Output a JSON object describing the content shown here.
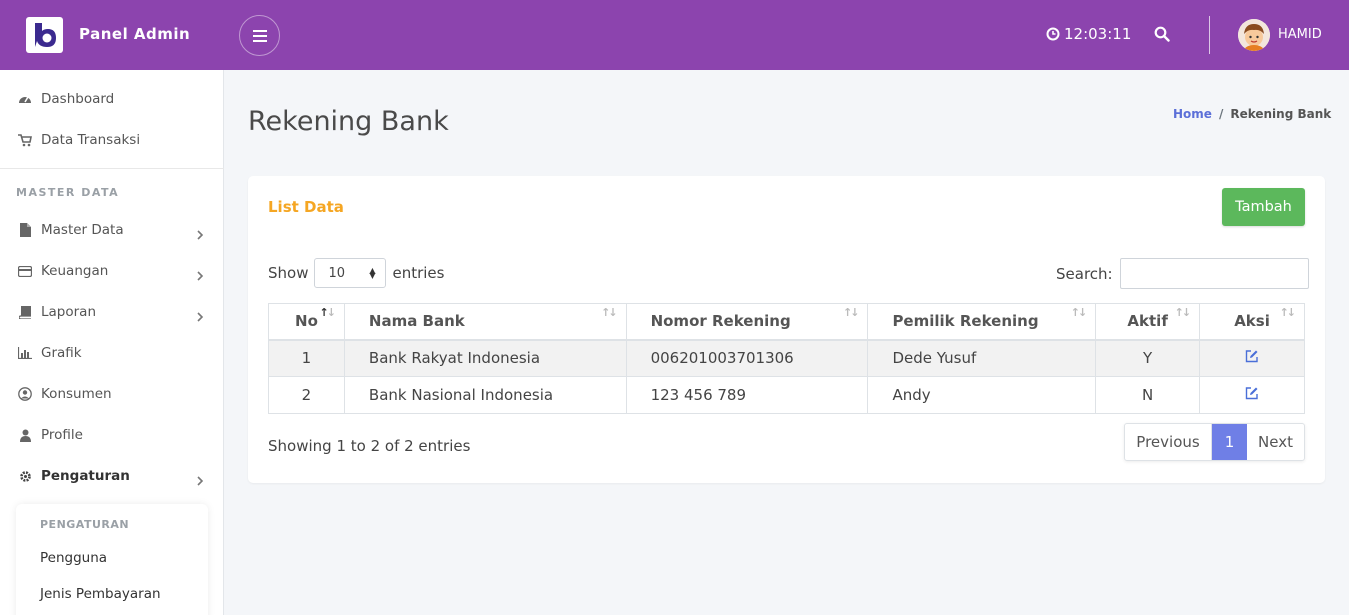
{
  "header": {
    "brand": "Panel Admin",
    "time": "12:03:11",
    "username": "HAMID",
    "accent": "#8c44ae"
  },
  "sidebar": {
    "items_top": [
      {
        "label": "Dashboard",
        "icon": "dashboard-icon"
      },
      {
        "label": "Data Transaksi",
        "icon": "cart-icon"
      }
    ],
    "section_label": "MASTER DATA",
    "items_master": [
      {
        "label": "Master Data",
        "icon": "file-icon",
        "has_children": true
      },
      {
        "label": "Keuangan",
        "icon": "credit-card-icon",
        "has_children": true
      },
      {
        "label": "Laporan",
        "icon": "book-icon",
        "has_children": true
      },
      {
        "label": "Grafik",
        "icon": "bar-chart-icon",
        "has_children": false
      },
      {
        "label": "Konsumen",
        "icon": "user-circle-icon",
        "has_children": false
      },
      {
        "label": "Profile",
        "icon": "user-icon",
        "has_children": false
      },
      {
        "label": "Pengaturan",
        "icon": "gear-icon",
        "has_children": true,
        "active": true
      }
    ],
    "submenu": {
      "header": "PENGATURAN",
      "items": [
        "Pengguna",
        "Jenis Pembayaran"
      ]
    }
  },
  "page": {
    "title": "Rekening Bank",
    "breadcrumb": {
      "home": "Home",
      "separator": "/",
      "current": "Rekening Bank"
    }
  },
  "card": {
    "title": "List Data",
    "add_button": "Tambah",
    "show_label": "Show",
    "page_length": "10",
    "entries_label": "entries",
    "search_label": "Search:",
    "search_value": ""
  },
  "table": {
    "columns": [
      "No",
      "Nama Bank",
      "Nomor Rekening",
      "Pemilik Rekening",
      "Aktif",
      "Aksi"
    ],
    "rows": [
      {
        "no": "1",
        "nama_bank": "Bank Rakyat Indonesia",
        "nomor_rekening": "006201003701306",
        "pemilik": "Dede Yusuf",
        "aktif": "Y"
      },
      {
        "no": "2",
        "nama_bank": "Bank Nasional Indonesia",
        "nomor_rekening": "123 456 789",
        "pemilik": "Andy",
        "aktif": "N"
      }
    ]
  },
  "footer": {
    "info": "Showing 1 to 2 of 2 entries",
    "previous": "Previous",
    "page": "1",
    "next": "Next"
  }
}
